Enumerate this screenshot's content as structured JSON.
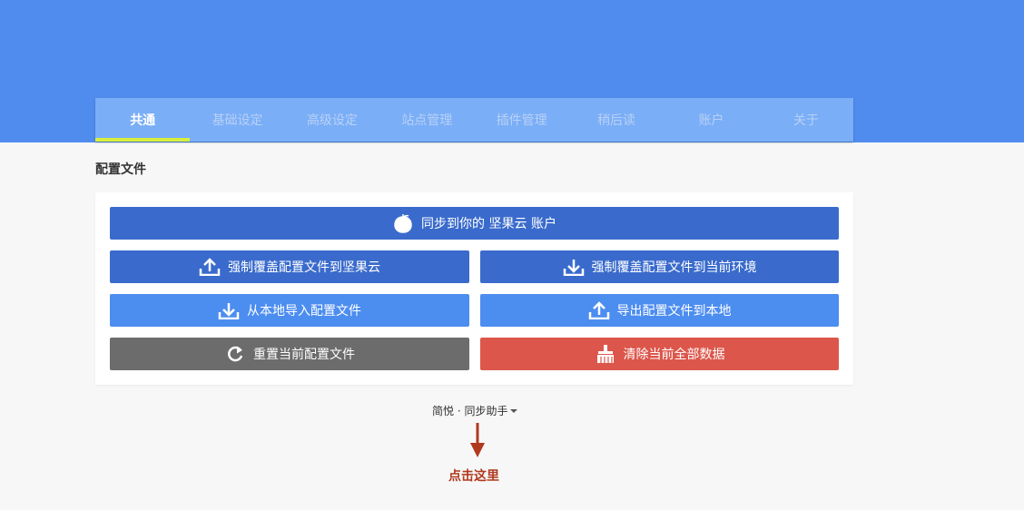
{
  "tabs": [
    {
      "label": "共通",
      "active": true
    },
    {
      "label": "基础设定",
      "active": false
    },
    {
      "label": "高级设定",
      "active": false
    },
    {
      "label": "站点管理",
      "active": false
    },
    {
      "label": "插件管理",
      "active": false
    },
    {
      "label": "稍后读",
      "active": false
    },
    {
      "label": "账户",
      "active": false
    },
    {
      "label": "关于",
      "active": false
    }
  ],
  "section": {
    "title": "配置文件"
  },
  "buttons": {
    "sync_account": {
      "label": "同步到你的 坚果云 账户",
      "icon": "nut-icon"
    },
    "force_upload": {
      "label": "强制覆盖配置文件到坚果云",
      "icon": "cloud-upload-icon"
    },
    "force_download": {
      "label": "强制覆盖配置文件到当前环境",
      "icon": "cloud-download-icon"
    },
    "import_local": {
      "label": "从本地导入配置文件",
      "icon": "cloud-download-icon"
    },
    "export_local": {
      "label": "导出配置文件到本地",
      "icon": "cloud-upload-icon"
    },
    "reset": {
      "label": "重置当前配置文件",
      "icon": "refresh-icon"
    },
    "clear": {
      "label": "清除当前全部数据",
      "icon": "broom-icon"
    }
  },
  "footer": {
    "menu_label": "简悦 · 同步助手"
  },
  "annotation": {
    "hint": "点击这里"
  },
  "colors": {
    "header": "#508cee",
    "tabbar": "#7aaef7",
    "tab_indicator": "#d9ef3c",
    "button_dark": "#3a6bcc",
    "button_light": "#4c8df0",
    "button_gray": "#6c6c6c",
    "button_red": "#dc564b",
    "annotation": "#b0391f"
  }
}
